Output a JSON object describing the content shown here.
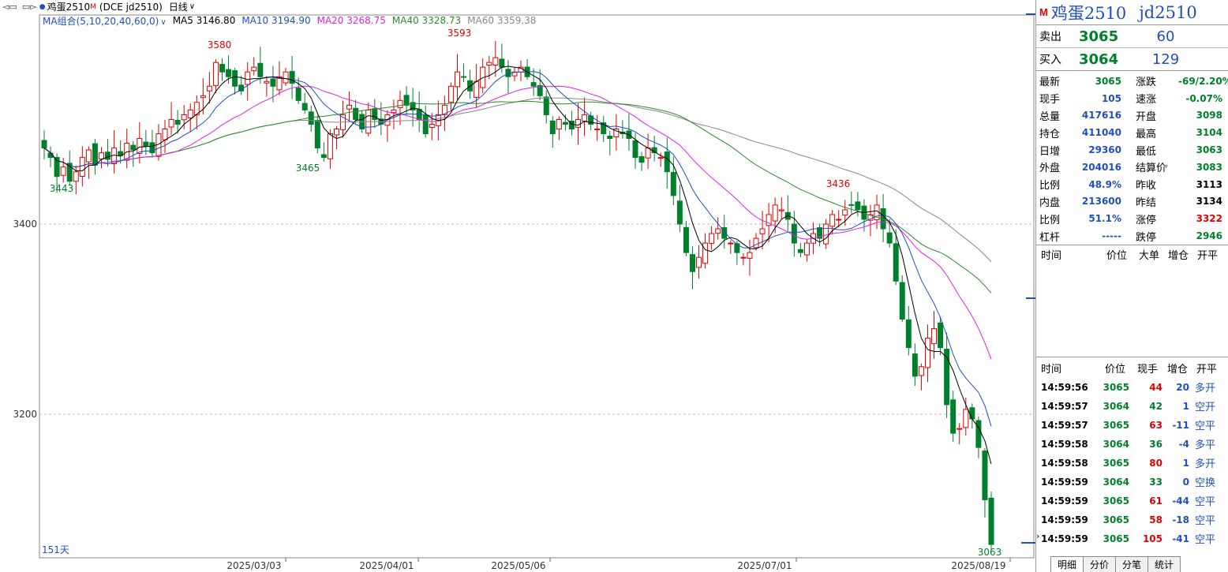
{
  "header": {
    "nav_left": "◅▭",
    "nav_right": "▭▻",
    "title": "鸡蛋2510",
    "title_badge": "M",
    "exchange_code": "(DCE jd2510)",
    "period": "日线",
    "period_dropdown": "∨"
  },
  "ma_legend": {
    "combo": "MA组合(5,10,20,40,60,0)",
    "combo_arrow": "∨",
    "ma5": "MA5 3146.80",
    "ma10": "MA10 3194.90",
    "ma20": "MA20 3268.75",
    "ma40": "MA40 3328.73",
    "ma60": "MA60 3359.38",
    "colors": {
      "ma5": "#000000",
      "ma10": "#1f4fbf",
      "ma20": "#e020e0",
      "ma40": "#2a8a2a",
      "ma60": "#888888"
    }
  },
  "chart_labels": {
    "y_ticks": [
      "3400",
      "3200"
    ],
    "x_ticks": [
      "2025/03/03",
      "2025/04/01",
      "2025/05/06",
      "2025/07/01",
      "2025/08/19"
    ],
    "days_label": "151天",
    "annotations": {
      "high1": "3580",
      "high2": "3593",
      "high3": "3436",
      "low1": "3443",
      "low2": "3465",
      "last": "3063"
    }
  },
  "chart_data": {
    "type": "candlestick",
    "title": "鸡蛋2510",
    "y_ticks": [
      3400,
      3200
    ],
    "x_ticks": [
      "2025/03/03",
      "2025/04/01",
      "2025/05/06",
      "2025/07/01",
      "2025/08/19"
    ],
    "num_days": 151,
    "closes": [
      3480,
      3470,
      3450,
      3460,
      3445,
      3455,
      3470,
      3478,
      3462,
      3475,
      3468,
      3480,
      3472,
      3485,
      3478,
      3490,
      3482,
      3475,
      3495,
      3500,
      3510,
      3505,
      3515,
      3520,
      3528,
      3535,
      3545,
      3570,
      3560,
      3555,
      3545,
      3540,
      3560,
      3565,
      3555,
      3550,
      3545,
      3555,
      3560,
      3548,
      3530,
      3520,
      3505,
      3480,
      3470,
      3495,
      3500,
      3515,
      3525,
      3510,
      3500,
      3520,
      3510,
      3505,
      3515,
      3520,
      3530,
      3525,
      3520,
      3510,
      3495,
      3505,
      3515,
      3525,
      3545,
      3560,
      3555,
      3540,
      3550,
      3565,
      3570,
      3575,
      3565,
      3555,
      3560,
      3565,
      3555,
      3545,
      3535,
      3515,
      3495,
      3510,
      3505,
      3500,
      3510,
      3515,
      3505,
      3500,
      3495,
      3490,
      3500,
      3495,
      3490,
      3470,
      3465,
      3480,
      3475,
      3470,
      3455,
      3430,
      3400,
      3370,
      3350,
      3365,
      3380,
      3390,
      3395,
      3385,
      3380,
      3370,
      3365,
      3370,
      3385,
      3395,
      3410,
      3420,
      3415,
      3405,
      3380,
      3370,
      3380,
      3390,
      3385,
      3400,
      3410,
      3405,
      3415,
      3420,
      3415,
      3405,
      3410,
      3420,
      3395,
      3380,
      3340,
      3300,
      3270,
      3240,
      3250,
      3280,
      3290,
      3270,
      3210,
      3180,
      3185,
      3205,
      3195,
      3165,
      3110,
      3063
    ],
    "ma5_last": 3146.8,
    "ma10_last": 3194.9,
    "ma20_last": 3268.75,
    "ma40_last": 3328.73,
    "ma60_last": 3359.38
  },
  "panel": {
    "title": "鸡蛋2510",
    "code": "jd2510",
    "badge": "M",
    "sell": {
      "label": "卖出",
      "price": "3065",
      "volume": "60"
    },
    "buy": {
      "label": "买入",
      "price": "3064",
      "volume": "129"
    },
    "stats": [
      {
        "l1": "最新",
        "v1": "3065",
        "c1": "green",
        "l2": "涨跌",
        "v2": "-69/2.20%",
        "c2": "green"
      },
      {
        "l1": "现手",
        "v1": "105",
        "c1": "blue",
        "l2": "速涨",
        "v2": "-0.07%",
        "c2": "green"
      },
      {
        "l1": "总量",
        "v1": "417616",
        "c1": "blue",
        "l2": "开盘",
        "v2": "3098",
        "c2": "green"
      },
      {
        "l1": "持仓",
        "v1": "411040",
        "c1": "blue",
        "l2": "最高",
        "v2": "3104",
        "c2": "green"
      },
      {
        "l1": "日增",
        "v1": "29360",
        "c1": "blue",
        "l2": "最低",
        "v2": "3063",
        "c2": "green"
      },
      {
        "l1": "外盘",
        "v1": "204016",
        "c1": "blue",
        "l2": "结算价",
        "v2": "3083",
        "c2": "green",
        "l2_arrow": "▾"
      },
      {
        "l1": "比例",
        "v1": "48.9%",
        "c1": "blue",
        "l2": "昨收",
        "v2": "3113",
        "c2": "dark"
      },
      {
        "l1": "内盘",
        "v1": "213600",
        "c1": "blue",
        "l2": "昨结",
        "v2": "3134",
        "c2": "dark"
      },
      {
        "l1": "比例",
        "v1": "51.1%",
        "c1": "blue",
        "l2": "涨停",
        "v2": "3322",
        "c2": "red"
      },
      {
        "l1": "杠杆",
        "v1": "-----",
        "c1": "blue",
        "l2": "跌停",
        "v2": "2946",
        "c2": "green"
      }
    ],
    "big_order_header": [
      "时间",
      "价位",
      "大单",
      "增仓",
      "开平"
    ],
    "trade_header": [
      "时间",
      "价位",
      "现手",
      "增仓",
      "开平"
    ],
    "trades": [
      {
        "time": "14:59:56",
        "price": "3065",
        "hand": "44",
        "hand_color": "red",
        "oi": "20",
        "kind": "多开"
      },
      {
        "time": "14:59:57",
        "price": "3064",
        "hand": "42",
        "hand_color": "green",
        "oi": "1",
        "kind": "空开"
      },
      {
        "time": "14:59:57",
        "price": "3065",
        "hand": "63",
        "hand_color": "red",
        "oi": "-11",
        "kind": "空平"
      },
      {
        "time": "14:59:58",
        "price": "3064",
        "hand": "36",
        "hand_color": "green",
        "oi": "-4",
        "kind": "多平"
      },
      {
        "time": "14:59:58",
        "price": "3065",
        "hand": "80",
        "hand_color": "red",
        "oi": "1",
        "kind": "多开"
      },
      {
        "time": "14:59:59",
        "price": "3064",
        "hand": "33",
        "hand_color": "green",
        "oi": "0",
        "kind": "空换"
      },
      {
        "time": "14:59:59",
        "price": "3065",
        "hand": "61",
        "hand_color": "red",
        "oi": "-44",
        "kind": "空平"
      },
      {
        "time": "14:59:59",
        "price": "3065",
        "hand": "58",
        "hand_color": "red",
        "oi": "-18",
        "kind": "空平"
      },
      {
        "time": "14:59:59",
        "price": "3065",
        "hand": "105",
        "hand_color": "red",
        "oi": "-41",
        "kind": "空平"
      }
    ],
    "tabs": [
      "明细",
      "分价",
      "分笔",
      "统计"
    ]
  }
}
